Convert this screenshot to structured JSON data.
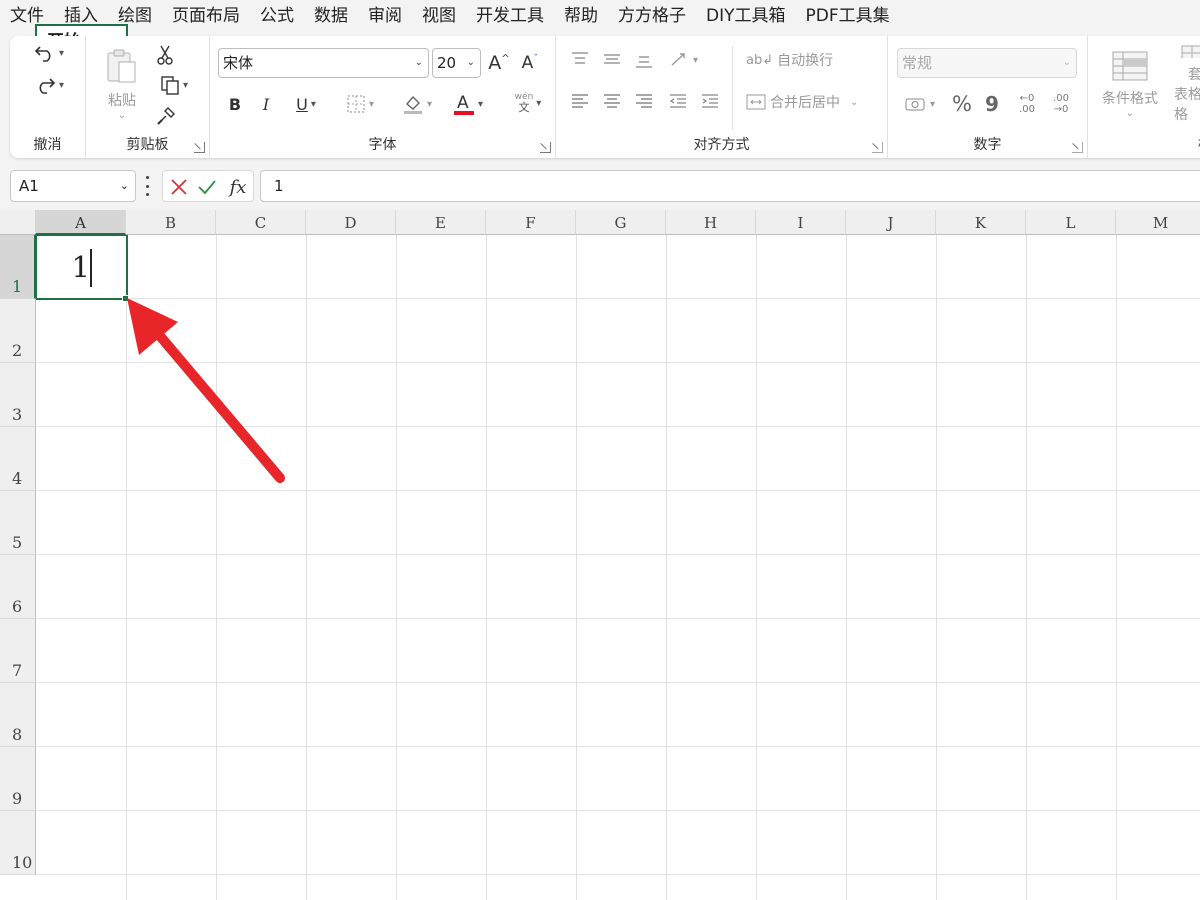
{
  "menu": [
    "文件",
    "开始",
    "插入",
    "绘图",
    "页面布局",
    "公式",
    "数据",
    "审阅",
    "视图",
    "开发工具",
    "帮助",
    "方方格子",
    "DIY工具箱",
    "PDF工具集"
  ],
  "menu_active_index": 1,
  "ribbon": {
    "undo_group_label": "撤消",
    "clipboard": {
      "paste_label": "粘贴",
      "group_label": "剪贴板"
    },
    "font": {
      "font_name": "宋体",
      "font_size": "20",
      "group_label": "字体",
      "phonetic_top": "wén",
      "phonetic_bottom": "文"
    },
    "alignment": {
      "wrap_text_label": "自动换行",
      "merge_center_label": "合并后居中",
      "group_label": "对齐方式"
    },
    "number": {
      "format_value": "常规",
      "group_label": "数字",
      "percent": "%",
      "comma": "9",
      "inc_decimal_top": "←0",
      "inc_decimal_bottom": ".00",
      "dec_decimal_top": ".00",
      "dec_decimal_bottom": "→0"
    },
    "styles": {
      "conditional_format_label": "条件格式",
      "table_format_label_1": "套",
      "table_format_label_2": "表格格"
    },
    "cells_group_partial": "样"
  },
  "formula_bar": {
    "name_box": "A1",
    "formula_value": "1",
    "fx": "fx"
  },
  "sheet": {
    "columns": [
      "A",
      "B",
      "C",
      "D",
      "E",
      "F",
      "G",
      "H",
      "I",
      "J",
      "K",
      "L",
      "M"
    ],
    "rows": [
      "1",
      "2",
      "3",
      "4",
      "5",
      "6",
      "7",
      "8",
      "9",
      "10"
    ],
    "active_cell": "A1",
    "active_cell_value": "1"
  },
  "colors": {
    "accent": "#1e7145",
    "arrow": "#e8262a",
    "font_color_bar": "#e81123"
  }
}
